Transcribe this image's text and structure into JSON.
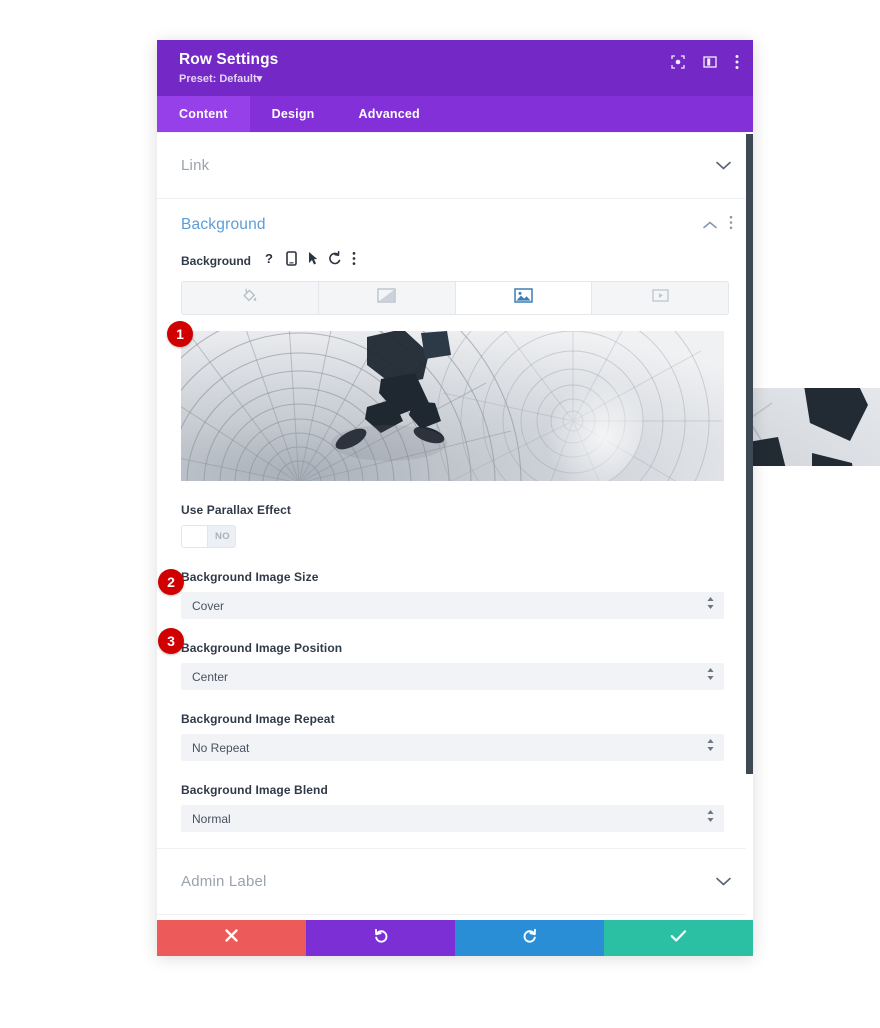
{
  "window": {
    "title": "Row Settings",
    "preset": "Preset: Default",
    "preset_caret": "▾",
    "header_icons": [
      {
        "name": "fullscreen-icon",
        "label": "Expand"
      },
      {
        "name": "layout-view-icon",
        "label": "Change Layout"
      },
      {
        "name": "more-options-icon",
        "label": "More Options"
      }
    ]
  },
  "tabs": [
    {
      "id": "content",
      "label": "Content",
      "active": true
    },
    {
      "id": "design",
      "label": "Design",
      "active": false
    },
    {
      "id": "advanced",
      "label": "Advanced",
      "active": false
    }
  ],
  "sections": {
    "link": {
      "title": "Link",
      "state": "collapsed",
      "chevron": "down"
    },
    "background": {
      "title": "Background",
      "state": "expanded",
      "chevron": "up",
      "field_label": "Background",
      "tool_icons": [
        {
          "name": "help-icon",
          "glyph": "?"
        },
        {
          "name": "responsive-mobile-icon",
          "glyph": "mobile"
        },
        {
          "name": "hover-cursor-icon",
          "glyph": "cursor"
        },
        {
          "name": "reset-icon",
          "glyph": "undo-arrow"
        },
        {
          "name": "more-options-icon",
          "glyph": "kebab"
        }
      ],
      "bg_types": [
        {
          "name": "background-color-tab",
          "icon": "paint-bucket-icon",
          "active": false
        },
        {
          "name": "background-gradient-tab",
          "icon": "gradient-icon",
          "active": false
        },
        {
          "name": "background-image-tab",
          "icon": "image-icon",
          "active": true
        },
        {
          "name": "background-video-tab",
          "icon": "video-icon",
          "active": false
        }
      ],
      "image_preview": {
        "name": "background-image-preview",
        "alt": "Person walking across circular cobblestone plaza"
      },
      "fields": [
        {
          "name": "use-parallax-effect",
          "label": "Use Parallax Effect",
          "type": "toggle",
          "value": "NO"
        },
        {
          "name": "background-image-size",
          "label": "Background Image Size",
          "type": "select",
          "value": "Cover"
        },
        {
          "name": "background-image-position",
          "label": "Background Image Position",
          "type": "select",
          "value": "Center"
        },
        {
          "name": "background-image-repeat",
          "label": "Background Image Repeat",
          "type": "select",
          "value": "No Repeat"
        },
        {
          "name": "background-image-blend",
          "label": "Background Image Blend",
          "type": "select",
          "value": "Normal"
        }
      ]
    },
    "admin_label": {
      "title": "Admin Label",
      "state": "collapsed",
      "chevron": "down"
    }
  },
  "help": {
    "label": "Help",
    "icon": "question-circle-icon"
  },
  "actions": [
    {
      "name": "cancel-button",
      "icon": "close-x-icon",
      "color": "#ed5a5a"
    },
    {
      "name": "undo-button",
      "icon": "undo-arrow-icon",
      "color": "#7b2fd4"
    },
    {
      "name": "redo-button",
      "icon": "redo-arrow-icon",
      "color": "#2a8ed6"
    },
    {
      "name": "save-button",
      "icon": "checkmark-icon",
      "color": "#2bbfa3"
    }
  ],
  "callouts": [
    {
      "number": "1",
      "target": "background-image-preview"
    },
    {
      "number": "2",
      "target": "background-image-size"
    },
    {
      "number": "3",
      "target": "background-image-position"
    }
  ],
  "colors": {
    "header_purple": "#7429c6",
    "tabbar_purple": "#8430d8",
    "tab_active_purple": "#9540e8",
    "section_title_blue": "#5b9dd9",
    "badge_red": "#d10000",
    "scrollbar_dark": "#3f4855"
  }
}
